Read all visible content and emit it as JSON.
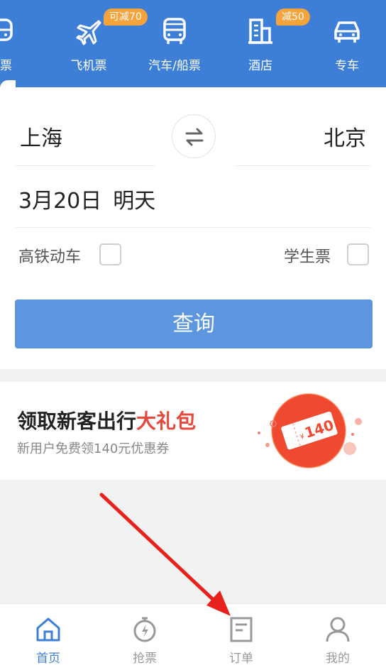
{
  "nav": {
    "items": [
      {
        "label": "车票",
        "icon": "train-icon"
      },
      {
        "label": "飞机票",
        "icon": "plane-icon",
        "badge": "可减70"
      },
      {
        "label": "汽车/船票",
        "icon": "bus-icon"
      },
      {
        "label": "酒店",
        "icon": "hotel-icon",
        "badge": "减50"
      },
      {
        "label": "专车",
        "icon": "car-icon"
      }
    ]
  },
  "search": {
    "from_city": "上海",
    "to_city": "北京",
    "date": "3月20日",
    "day_label": "明天",
    "option_highspeed": "高铁动车",
    "option_student": "学生票",
    "button_label": "查询"
  },
  "promo": {
    "title_prefix": "领取新客出行",
    "title_highlight": "大礼包",
    "subtitle": "新用户免费领140元优惠券",
    "coupon_value": "140",
    "coupon_symbol": "¥"
  },
  "tabbar": {
    "tabs": [
      {
        "label": "首页",
        "icon": "home-icon",
        "active": true
      },
      {
        "label": "抢票",
        "icon": "stopwatch-icon",
        "active": false
      },
      {
        "label": "订单",
        "icon": "order-icon",
        "active": false
      },
      {
        "label": "我的",
        "icon": "profile-icon",
        "active": false
      }
    ]
  },
  "colors": {
    "brand_blue": "#3d7fd6",
    "button_blue": "#5b96df",
    "badge_orange": "#f5a33a",
    "highlight_red": "#e8483c",
    "annotation_arrow": "#e8211c"
  }
}
